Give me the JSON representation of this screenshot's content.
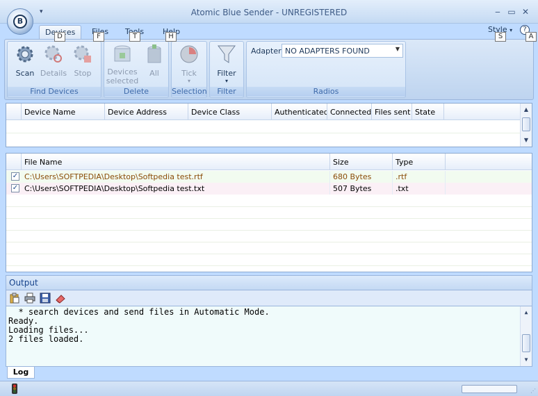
{
  "window": {
    "title": "Atomic Blue Sender - UNREGISTERED",
    "orb_letter": "B",
    "qat_arrow": "▾",
    "min_glyph": "‒",
    "max_glyph": "▭",
    "close_glyph": "✕"
  },
  "ribbon": {
    "tabs": [
      {
        "label": "Devices",
        "keytip": "D"
      },
      {
        "label": "Files",
        "keytip": "F"
      },
      {
        "label": "Tools",
        "keytip": "T"
      },
      {
        "label": "Help",
        "keytip": "H"
      }
    ],
    "style_label": "Style",
    "style_keytip": "S",
    "help_glyph": "?",
    "help_keytip": "A",
    "groups": {
      "find_devices": {
        "label": "Find Devices",
        "buttons": [
          "Scan",
          "Details",
          "Stop"
        ]
      },
      "delete": {
        "label": "Delete",
        "buttons": [
          "Devices selected",
          "All"
        ]
      },
      "selection": {
        "label": "Selection",
        "buttons": [
          "Tick"
        ]
      },
      "filter": {
        "label": "Filter",
        "buttons": [
          "Filter"
        ]
      },
      "radios": {
        "label": "Radios",
        "adapter_label": "Adapter:",
        "adapter_value": "NO ADAPTERS FOUND"
      }
    }
  },
  "devices_grid": {
    "columns": [
      "Device Name",
      "Device Address",
      "Device Class",
      "Authenticated",
      "Connected",
      "Files sent",
      "State"
    ]
  },
  "files_grid": {
    "columns": [
      "File Name",
      "Size",
      "Type"
    ],
    "rows": [
      {
        "checked": "✓",
        "file_name": "C:\\Users\\SOFTPEDIA\\Desktop\\Softpedia test.rtf",
        "size": "680 Bytes",
        "type": ".rtf",
        "color": "#8a4b08"
      },
      {
        "checked": "✓",
        "file_name": "C:\\Users\\SOFTPEDIA\\Desktop\\Softpedia test.txt",
        "size": "507 Bytes",
        "type": ".txt",
        "color": "#000000"
      }
    ]
  },
  "output": {
    "header": "Output",
    "log_lines": [
      "  * search devices and send files in Automatic Mode.",
      "Ready.",
      "Loading files...",
      "2 files loaded."
    ],
    "tab_label": "Log"
  },
  "colors": {
    "accent": "#15428b",
    "row_rtf_bg": "#f2fbf0",
    "row_txt_bg": "#fbf0f6"
  }
}
